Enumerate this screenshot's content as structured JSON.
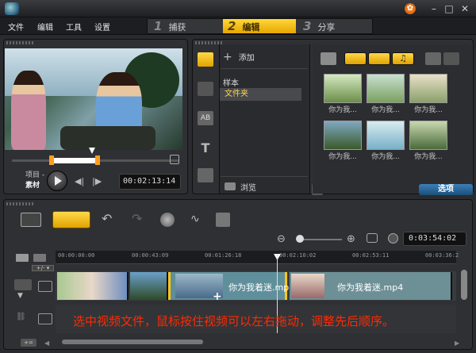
{
  "menu": {
    "items": [
      "文件",
      "编辑",
      "工具",
      "设置"
    ]
  },
  "steps": [
    {
      "num": "1",
      "label": "捕获"
    },
    {
      "num": "2",
      "label": "编辑"
    },
    {
      "num": "3",
      "label": "分享"
    }
  ],
  "player": {
    "mode_project": "项目 -",
    "mode_clip": "素材",
    "timecode": "00:02:13:14"
  },
  "library": {
    "add_label": "添加",
    "sample_label": "样本",
    "folder_label": "文件夹",
    "browse_label": "浏览",
    "options_label": "选项",
    "thumbs": [
      "你为我...",
      "你为我...",
      "你为我...",
      "你为我...",
      "你为我...",
      "你为我..."
    ]
  },
  "timeline": {
    "timecode": "0:03:54:02",
    "ruler_ticks": [
      "00:00:00:00",
      "00:00:43:09",
      "00:01:26:18",
      "00:02:10:02",
      "00:02:53:11",
      "00:03:36:2"
    ],
    "clip_label_1": "你为我着迷.mp",
    "clip_label_2": "你为我着迷.mp4",
    "caption": "选中视频文件，鼠标按住视频可以左右拖动，调整先后顺序。"
  },
  "colors": {
    "accent": "#ffc61a",
    "caption": "#ff2a00",
    "options": "#2b6ea5"
  }
}
